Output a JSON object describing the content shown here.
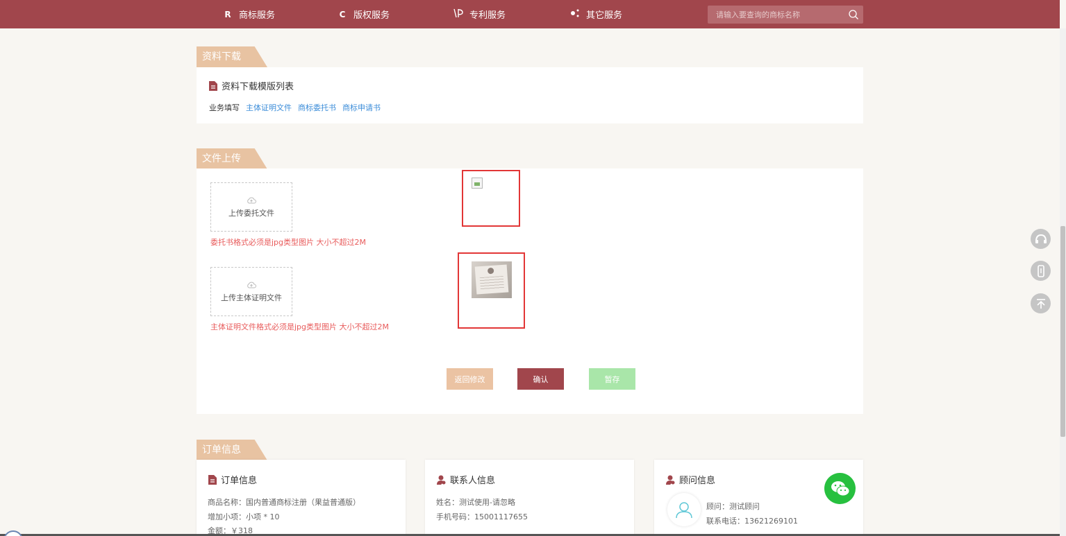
{
  "nav": {
    "items": [
      {
        "icon": "R",
        "label": "商标服务"
      },
      {
        "icon": "C",
        "label": "版权服务"
      },
      {
        "icon": "patent-icon",
        "label": "专利服务"
      },
      {
        "icon": "dots-icon",
        "label": "其它服务"
      }
    ],
    "search_placeholder": "请输入要查询的商标名称"
  },
  "download": {
    "tag": "资料下载",
    "title": "资料下载模版列表",
    "label": "业务填写",
    "links": [
      "主体证明文件",
      "商标委托书",
      "商标申请书"
    ]
  },
  "upload": {
    "tag": "文件上传",
    "boxes": [
      {
        "label": "上传委托文件",
        "hint": "委托书格式必须是jpg类型图片 大小不超过2M"
      },
      {
        "label": "上传主体证明文件",
        "hint": "主体证明文件格式必须是jpg类型图片 大小不超过2M"
      }
    ],
    "buttons": {
      "back": "返回修改",
      "confirm": "确认",
      "save": "暂存"
    }
  },
  "order": {
    "tag": "订单信息",
    "order_card": {
      "title": "订单信息",
      "product": "商品名称：国内普通商标注册（果益普通版）",
      "extra": "增加小项：小项 * 10",
      "amount": "金额：￥318"
    },
    "contact_card": {
      "title": "联系人信息",
      "name": "姓名：测试使用-请忽略",
      "phone": "手机号码：15001117655"
    },
    "advisor_card": {
      "title": "顾问信息",
      "advisor": "顾问：测试顾问",
      "phone": "联系电话：13621269101"
    }
  },
  "colors": {
    "brand": "#a1464c",
    "tag": "#e8c3a2",
    "link": "#3c8dd9",
    "warning": "#e85b5b",
    "save": "#a9e6a9",
    "wechat": "#27c03f"
  }
}
